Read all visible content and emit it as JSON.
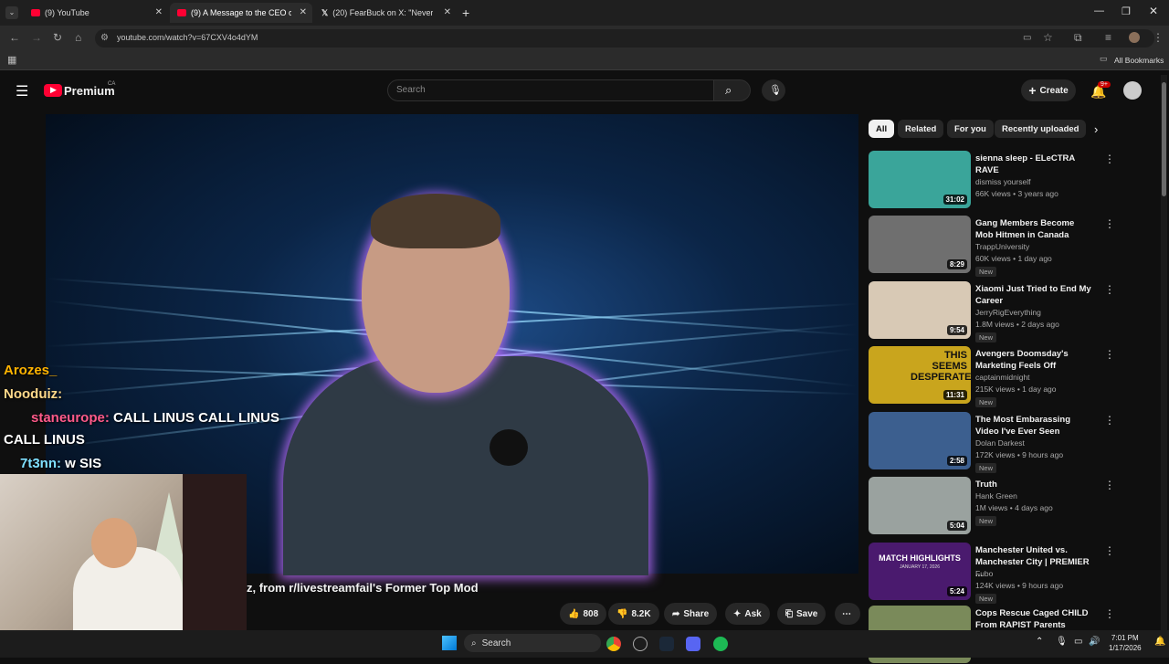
{
  "browser": {
    "tabs": [
      {
        "title": "(9) YouTube"
      },
      {
        "title": "(9) A Message to the CEO of Re"
      },
      {
        "title": "(20) FearBuck on X: \"Never bef"
      }
    ],
    "url": "youtube.com/watch?v=67CXV4o4dYM",
    "bookmarks_label": "All Bookmarks"
  },
  "youtube": {
    "logo_text": "Premium",
    "region": "CA",
    "search_placeholder": "Search",
    "create_label": "Create",
    "notif_count": "9+"
  },
  "chat_overlay": [
    {
      "user": "Arozes_",
      "text": ""
    },
    {
      "user": "Nooduiz:",
      "text": ""
    },
    {
      "user": "staneurope:",
      "text": "CALL LINUS CALL LINUS"
    },
    {
      "user": "",
      "text": "CALL LINUS"
    },
    {
      "user": "7t3nn:",
      "text": "w SIS"
    }
  ],
  "video": {
    "title_fragment": "z, from r/livestreamfail's Former Top Mod",
    "likes": "808",
    "dislikes": "8.2K",
    "share": "Share",
    "ask": "Ask",
    "save": "Save"
  },
  "chips": [
    "All",
    "Related",
    "For you",
    "Recently uploaded"
  ],
  "recommendations": [
    {
      "title": "sienna sleep - ELeCTRA RAVE",
      "channel": "dismiss yourself",
      "meta": "66K views • 3 years ago",
      "duration": "31:02",
      "new": "",
      "color": "#3aa59a"
    },
    {
      "title": "Gang Members Become Mob Hitmen in Canada",
      "channel": "TrappUniversity",
      "meta": "60K views • 1 day ago",
      "duration": "8:29",
      "new": "New",
      "color": "#6f6f6f"
    },
    {
      "title": "Xiaomi Just Tried to End My Career",
      "channel": "JerryRigEverything",
      "meta": "1.8M views • 2 days ago",
      "duration": "9:54",
      "new": "New",
      "color": "#d8c9b5"
    },
    {
      "title": "Avengers Doomsday's Marketing Feels Off",
      "channel": "captainmidnight",
      "meta": "215K views • 1 day ago",
      "duration": "11:31",
      "new": "New",
      "color": "#c9a51d"
    },
    {
      "title": "The Most Embarassing Video I've Ever Seen",
      "channel": "Dolan Darkest",
      "meta": "172K views • 9 hours ago",
      "duration": "2:58",
      "new": "New",
      "color": "#3c5f8f"
    },
    {
      "title": "Truth",
      "channel": "Hank Green",
      "meta": "1M views • 4 days ago",
      "duration": "5:04",
      "new": "New",
      "color": "#9aa29f"
    },
    {
      "title": "Manchester United vs. Manchester City | PREMIER ...",
      "channel": "Fubo",
      "meta": "124K views • 9 hours ago",
      "duration": "5:24",
      "new": "New",
      "color": "#4a1a6e"
    },
    {
      "title": "Cops Rescue Caged CHILD From RAPIST Parents",
      "channel": "",
      "meta": "",
      "duration": "",
      "new": "",
      "color": "#7a8a5a"
    }
  ],
  "thumb_text": {
    "avengers": "THIS SEEMS DESPERATE",
    "fubo": "MATCH HIGHLIGHTS",
    "fubo_date": "JANUARY 17, 2026"
  },
  "taskbar": {
    "search": "Search",
    "time": "7:01 PM",
    "date": "1/17/2026"
  }
}
